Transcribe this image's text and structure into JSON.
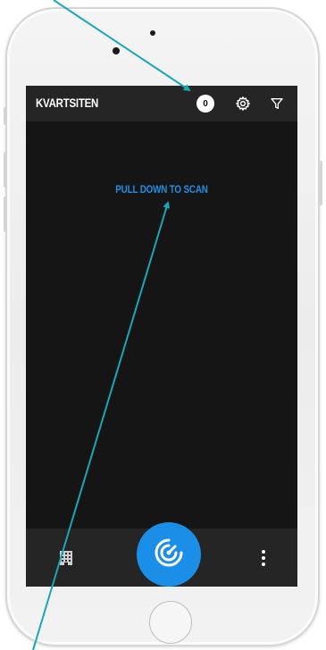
{
  "app": {
    "title": "KVARTSITEN",
    "badge_count": "0",
    "hint": "PULL DOWN TO SCAN"
  },
  "icons": {
    "settings": "gear-icon",
    "filter": "filter-icon",
    "grid": "building-grid-icon",
    "scan": "radar-scan-icon",
    "more": "more-vertical-icon"
  },
  "colors": {
    "accent": "#1B8FE8",
    "hint_text": "#1F8EE6",
    "screen_bg": "#151515",
    "bar_bg": "#252525",
    "annotation_arrow": "#1AA7B5"
  }
}
